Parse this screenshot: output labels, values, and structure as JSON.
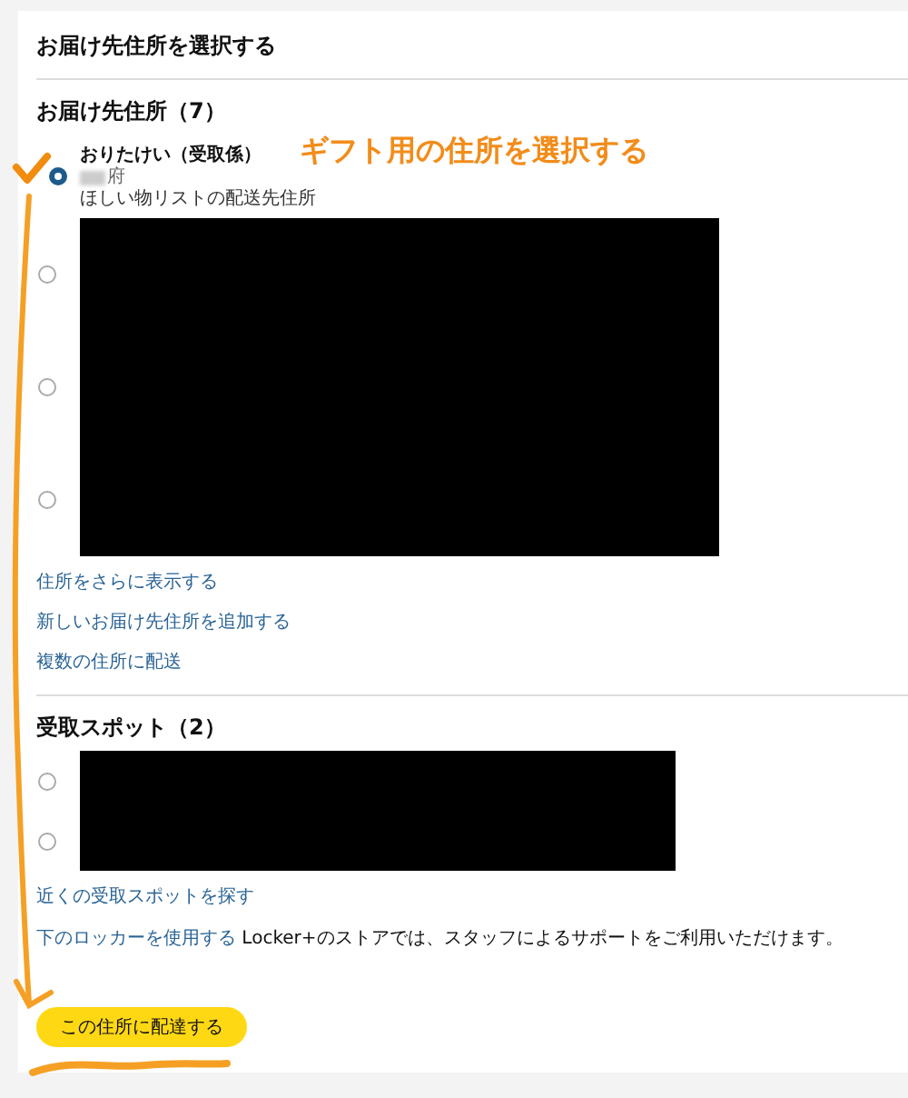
{
  "header": {
    "title": "お届け先住所を選択する"
  },
  "addresses": {
    "heading": "お届け先住所（7）",
    "options": [
      {
        "kind": "shown",
        "selected": true,
        "name": "おりたけい（受取係）",
        "line": "府",
        "note": "ほしい物リストの配送先住所"
      },
      {
        "kind": "redacted",
        "selected": false
      },
      {
        "kind": "redacted",
        "selected": false
      },
      {
        "kind": "redacted",
        "selected": false
      }
    ],
    "links": [
      "住所をさらに表示する",
      "新しいお届け先住所を追加する",
      "複数の住所に配送"
    ]
  },
  "pickup": {
    "heading": "受取スポット（2）",
    "options": [
      {
        "kind": "redacted",
        "selected": false
      },
      {
        "kind": "redacted",
        "selected": false
      }
    ],
    "links": [
      "近くの受取スポットを探す"
    ],
    "note": {
      "link": "下のロッカーを使用する",
      "text": "Locker+のストアでは、スタッフによるサポートをご利用いただけます。"
    }
  },
  "button": "この住所に配達する",
  "annotation": {
    "callout": "ギフト用の住所を選択する"
  }
}
